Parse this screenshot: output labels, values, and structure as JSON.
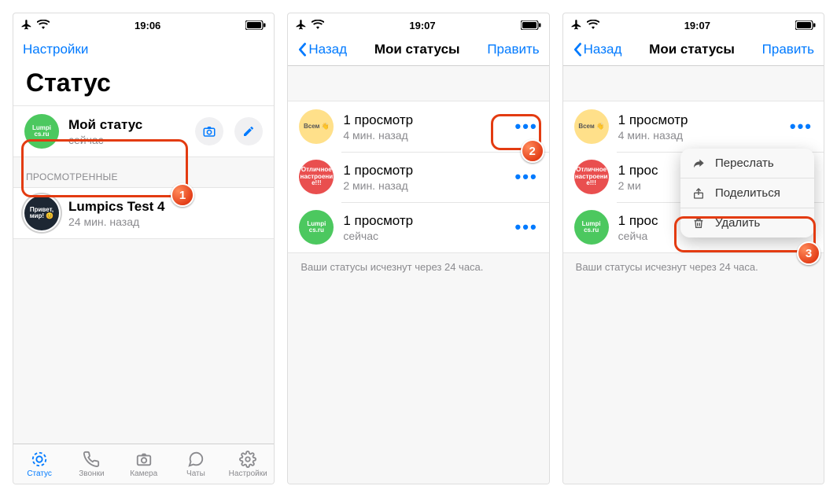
{
  "screens": {
    "a": {
      "time": "19:06",
      "nav": {
        "left": "Настройки"
      },
      "bigtitle": "Статус",
      "myStatus": {
        "avatarText": "Lumpi cs.ru",
        "title": "Мой статус",
        "sub": "сейчас"
      },
      "viewedHeader": "ПРОСМОТРЕННЫЕ",
      "viewed": {
        "avatarText": "Привет, мир! 😊",
        "title": "Lumpics Test 4",
        "sub": "24 мин. назад"
      },
      "tabs": {
        "status": "Статус",
        "calls": "Звонки",
        "camera": "Камера",
        "chats": "Чаты",
        "settings": "Настройки"
      }
    },
    "b": {
      "time": "19:07",
      "nav": {
        "back": "Назад",
        "title": "Мои статусы",
        "right": "Править"
      },
      "rows": [
        {
          "avatarText": "Всем 👋",
          "title": "1 просмотр",
          "sub": "4 мин. назад"
        },
        {
          "avatarText": "Отличное настроени е!!!",
          "title": "1 просмотр",
          "sub": "2 мин. назад"
        },
        {
          "avatarText": "Lumpi cs.ru",
          "title": "1 просмотр",
          "sub": "сейчас"
        }
      ],
      "footnote": "Ваши статусы исчезнут через 24 часа."
    },
    "c": {
      "time": "19:07",
      "nav": {
        "back": "Назад",
        "title": "Мои статусы",
        "right": "Править"
      },
      "rows": [
        {
          "avatarText": "Всем 👋",
          "title": "1 просмотр",
          "sub": "4 мин. назад"
        },
        {
          "avatarText": "Отличное настроени е!!!",
          "title": "1 прос",
          "sub": "2 ми"
        },
        {
          "avatarText": "Lumpi cs.ru",
          "title": "1 прос",
          "sub": "сейча"
        }
      ],
      "footnote": "Ваши статусы исчезнут через 24 часа.",
      "popover": {
        "forward": "Переслать",
        "share": "Поделиться",
        "delete": "Удалить"
      }
    }
  },
  "badges": {
    "one": "1",
    "two": "2",
    "three": "3"
  }
}
